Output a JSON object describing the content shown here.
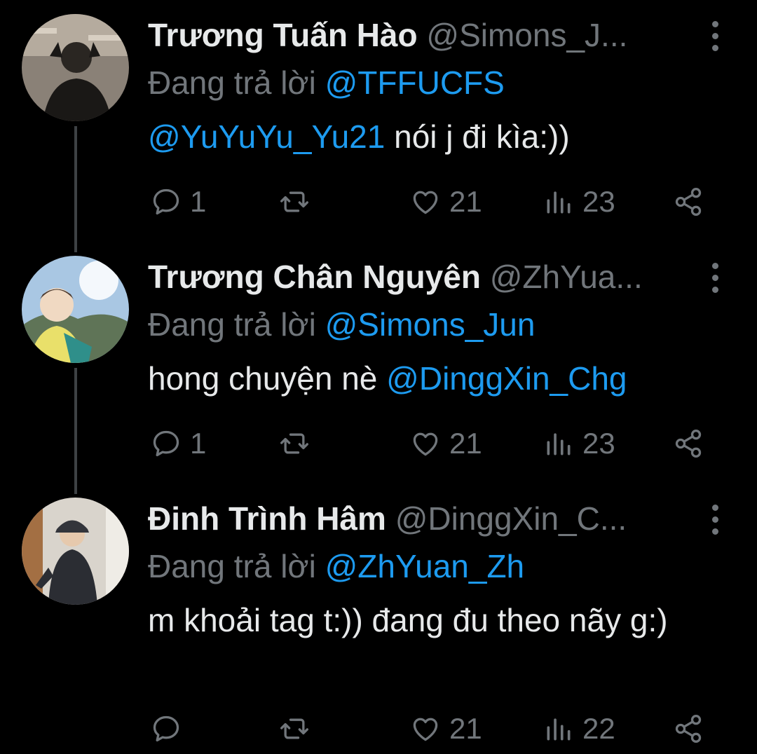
{
  "colors": {
    "background": "#000000",
    "text": "#e7e9ea",
    "muted": "#71767b",
    "link": "#1d9bf0",
    "thread_line": "#3e4144"
  },
  "tweets": [
    {
      "name": "Trương Tuấn Hào",
      "handle": "@Simons_J...",
      "replying_prefix": "Đang trả lời",
      "replying_to": "@TFFUCFS",
      "body_mention": "@YuYuYu_Yu21",
      "body_text": " nói j đi kìa:))",
      "actions": {
        "reply_count": "1",
        "retweet_count": "",
        "like_count": "21",
        "view_count": "23"
      },
      "icons": [
        "reply-icon",
        "retweet-icon",
        "like-icon",
        "views-icon",
        "share-icon",
        "more-icon"
      ]
    },
    {
      "name": "Trương Chân Nguyên",
      "handle": "@ZhYua...",
      "replying_prefix": "Đang trả lời",
      "replying_to": "@Simons_Jun",
      "body_text": "hong chuyện nè ",
      "body_mention": "@DinggXin_Chg",
      "actions": {
        "reply_count": "1",
        "retweet_count": "",
        "like_count": "21",
        "view_count": "23"
      }
    },
    {
      "name": "Đinh Trình Hâm",
      "handle": "@DinggXin_C...",
      "replying_prefix": "Đang trả lời",
      "replying_to": "@ZhYuan_Zh",
      "body_text": "m khoải tag t:)) đang đu theo nãy g:)",
      "actions": {
        "reply_count": "",
        "retweet_count": "",
        "like_count": "21",
        "view_count": "22"
      }
    }
  ]
}
